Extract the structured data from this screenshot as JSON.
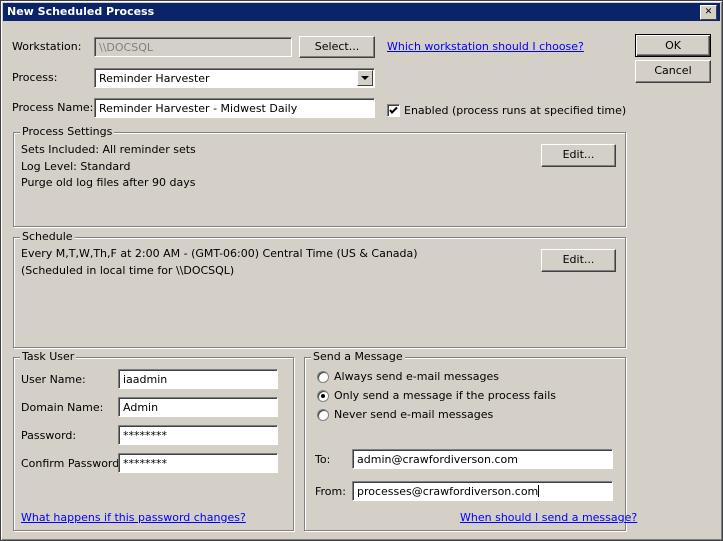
{
  "window": {
    "title": "New Scheduled Process",
    "close_glyph": "✕"
  },
  "buttons": {
    "ok": "OK",
    "cancel": "Cancel"
  },
  "workstation": {
    "label": "Workstation:",
    "value": "\\\\DOCSQL",
    "select_label": "Select...",
    "help_link": "Which workstation should I choose?"
  },
  "process": {
    "label": "Process:",
    "value": "Reminder Harvester",
    "name_label": "Process Name:",
    "name_value": "Reminder Harvester - Midwest Daily",
    "enabled_label": "Enabled (process runs at specified time)",
    "enabled": true
  },
  "process_settings": {
    "title": "Process Settings",
    "lines": [
      "Sets Included: All reminder sets",
      "Log Level: Standard",
      "Purge old log files after 90 days"
    ],
    "edit_label": "Edit..."
  },
  "schedule": {
    "title": "Schedule",
    "lines": [
      "Every M,T,W,Th,F at 2:00 AM - (GMT-06:00) Central Time (US & Canada)",
      "(Scheduled in local time for \\\\DOCSQL)"
    ],
    "edit_label": "Edit..."
  },
  "task_user": {
    "title": "Task User",
    "user_name_label": "User Name:",
    "user_name_value": "iaadmin",
    "domain_label": "Domain Name:",
    "domain_value": "Admin",
    "password_label": "Password:",
    "password_value": "********",
    "confirm_label": "Confirm Password:",
    "confirm_value": "********",
    "help_link": "What happens if this password changes?"
  },
  "send_message": {
    "title": "Send a Message",
    "options": [
      {
        "label": "Always send e-mail messages",
        "selected": false
      },
      {
        "label": "Only send a message if the process fails",
        "selected": true
      },
      {
        "label": "Never send e-mail messages",
        "selected": false
      }
    ],
    "to_label": "To:",
    "to_value": "admin@crawfordiverson.com",
    "from_label": "From:",
    "from_value": "processes@crawfordiverson.com",
    "help_link": "When should I send a message?"
  }
}
